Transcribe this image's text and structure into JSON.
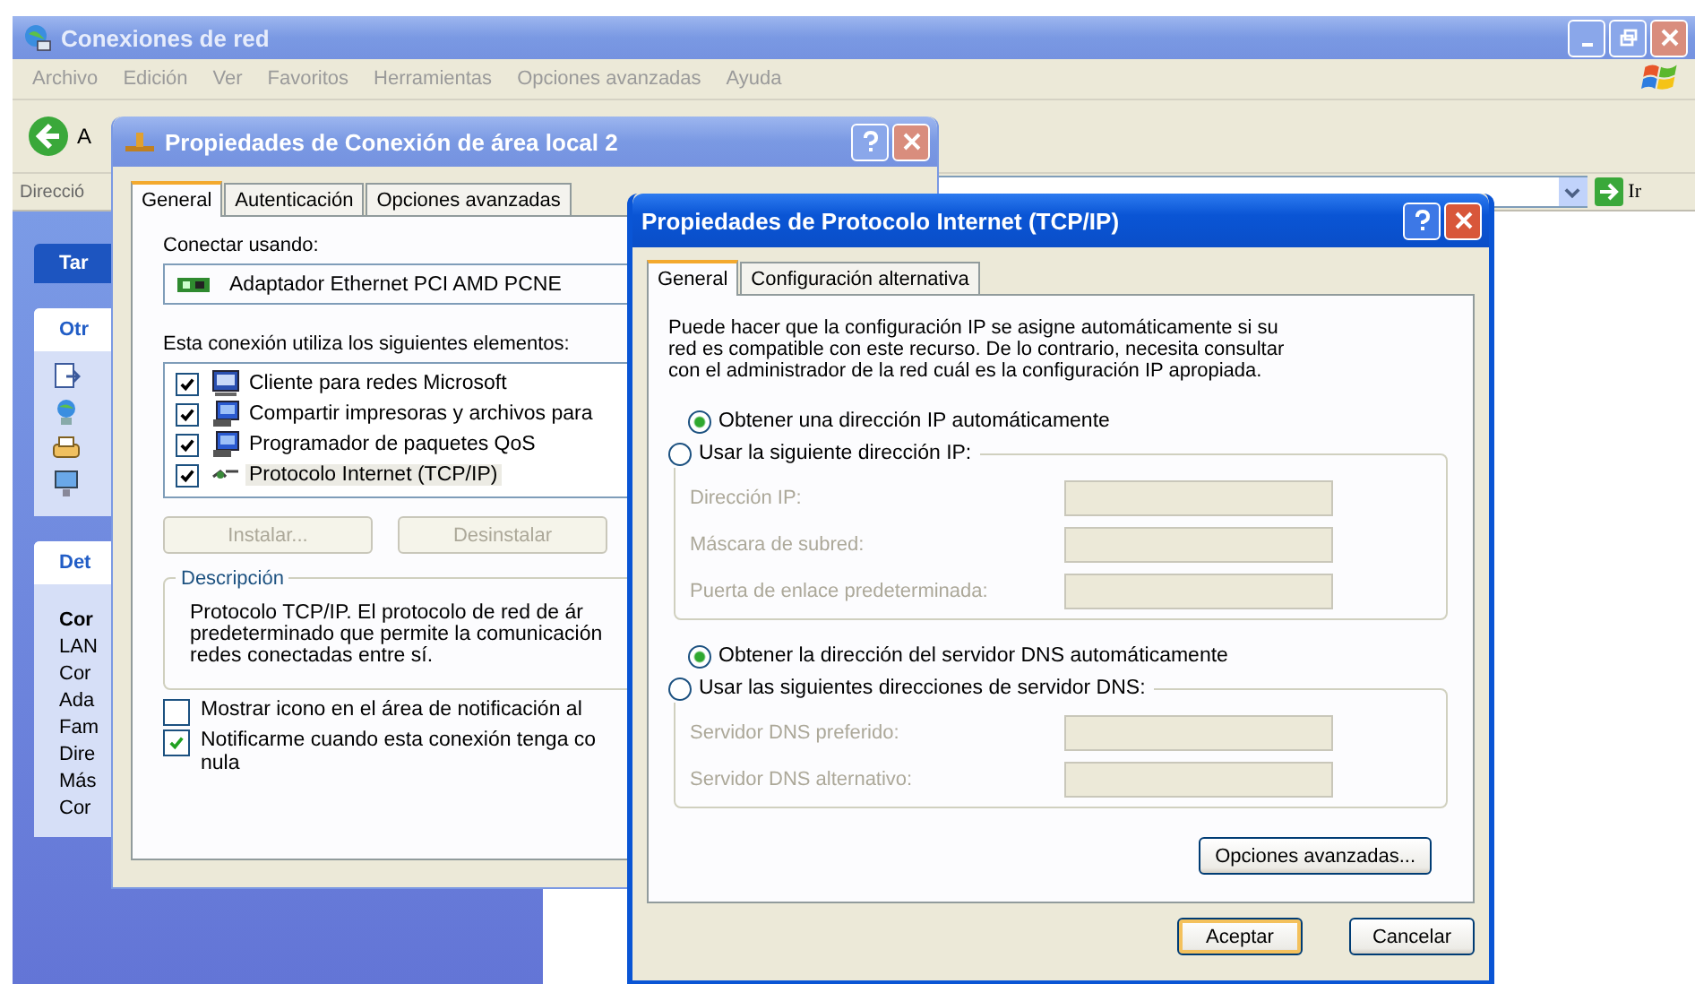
{
  "main_window": {
    "title": "Conexiones de red",
    "active": false,
    "menu": [
      "Archivo",
      "Edición",
      "Ver",
      "Favoritos",
      "Herramientas",
      "Opciones avanzadas",
      "Ayuda"
    ],
    "toolbar": {
      "back_label": "A"
    },
    "address": {
      "label": "Direcció",
      "go_label": "Ir"
    },
    "task_pane": [
      {
        "kind": "header",
        "title": "Tar"
      },
      {
        "kind": "icons",
        "title": "Otr"
      },
      {
        "kind": "details",
        "title": "Det",
        "lines": [
          "Cor",
          "LAN",
          "Cor",
          "Ada",
          "Fam",
          "Dire",
          "Más",
          "Cor"
        ]
      }
    ]
  },
  "connection_dialog": {
    "title": "Propiedades de Conexión de área local 2",
    "active": false,
    "tabs": [
      {
        "label": "General",
        "selected": true
      },
      {
        "label": "Autenticación",
        "selected": false
      },
      {
        "label": "Opciones avanzadas",
        "selected": false
      }
    ],
    "connect_using_label": "Conectar usando:",
    "adapter": "Adaptador Ethernet PCI AMD PCNE",
    "components_label": "Esta conexión utiliza los siguientes elementos:",
    "components": [
      {
        "name": "Cliente para redes Microsoft",
        "kind": "client",
        "checked": true,
        "selected": false
      },
      {
        "name": "Compartir impresoras y archivos para",
        "kind": "service",
        "checked": true,
        "selected": false
      },
      {
        "name": "Programador de paquetes QoS",
        "kind": "service",
        "checked": true,
        "selected": false
      },
      {
        "name": "Protocolo Internet (TCP/IP)",
        "kind": "protocol",
        "checked": true,
        "selected": true
      }
    ],
    "buttons": [
      {
        "label": "Instalar...",
        "disabled": true
      },
      {
        "label": "Desinstalar",
        "disabled": true
      }
    ],
    "description": {
      "legend": "Descripción",
      "lines": [
        "Protocolo TCP/IP. El protocolo de red de ár",
        "predeterminado que permite la comunicación",
        "redes conectadas entre sí."
      ]
    },
    "options": [
      {
        "lines": [
          "Mostrar icono en el área de notificación al"
        ],
        "checked": false
      },
      {
        "lines": [
          "Notificarme cuando esta conexión tenga co",
          "nula"
        ],
        "checked": true
      }
    ]
  },
  "tcpip_dialog": {
    "title": "Propiedades de Protocolo Internet (TCP/IP)",
    "active": true,
    "tabs": [
      {
        "label": "General",
        "selected": true
      },
      {
        "label": "Configuración alternativa",
        "selected": false
      }
    ],
    "intro": "Puede hacer que la configuración IP se asigne automáticamente si su red es compatible con este recurso. De lo contrario, necesita consultar con el administrador de la red cuál es la configuración IP apropiada.",
    "sections": [
      {
        "choices": [
          {
            "label": "Obtener una dirección IP automáticamente",
            "selected": true
          },
          {
            "label": "Usar la siguiente dirección IP:",
            "selected": false
          }
        ],
        "fields": [
          {
            "label": "Dirección IP:",
            "disabled": true
          },
          {
            "label": "Máscara de subred:",
            "disabled": true
          },
          {
            "label": "Puerta de enlace predeterminada:",
            "disabled": true
          }
        ]
      },
      {
        "choices": [
          {
            "label": "Obtener la dirección del servidor DNS automáticamente",
            "selected": true
          },
          {
            "label": "Usar las siguientes direcciones de servidor DNS:",
            "selected": false
          }
        ],
        "fields": [
          {
            "label": "Servidor DNS preferido:",
            "disabled": true
          },
          {
            "label": "Servidor DNS alternativo:",
            "disabled": true
          }
        ]
      }
    ],
    "advanced_button": "Opciones avanzadas...",
    "buttons": [
      {
        "label": "Aceptar",
        "default": true
      },
      {
        "label": "Cancelar",
        "default": false
      }
    ]
  }
}
